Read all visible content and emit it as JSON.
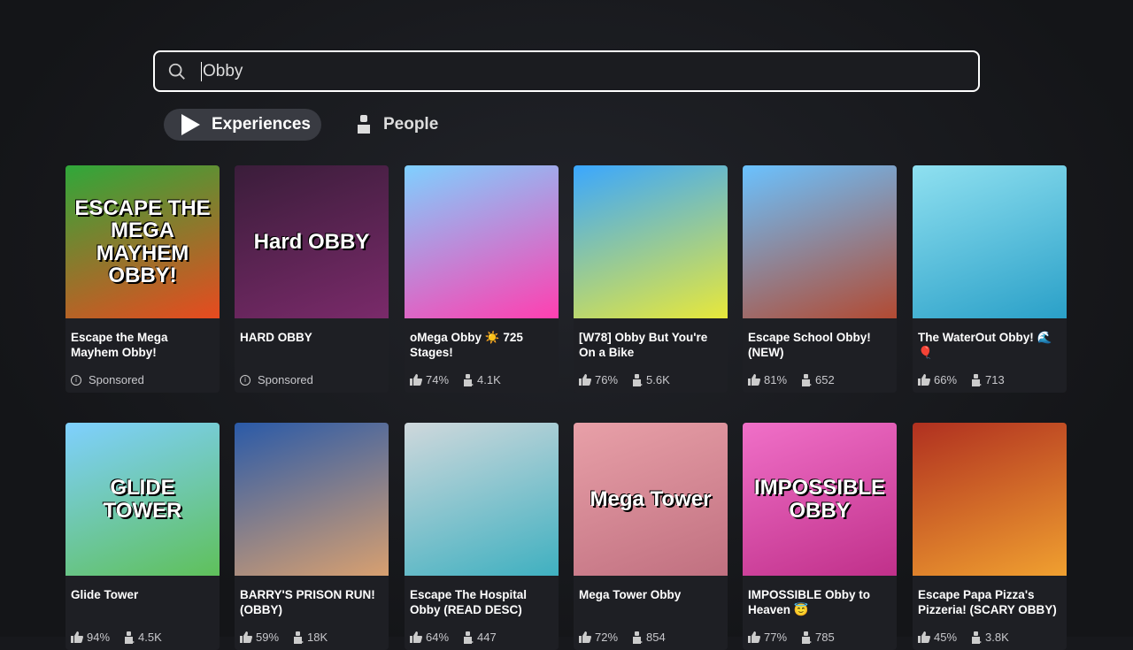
{
  "search": {
    "value": "Obby"
  },
  "tabs": [
    {
      "label": "Experiences",
      "active": true
    },
    {
      "label": "People",
      "active": false
    }
  ],
  "games": [
    {
      "title": "Escape the Mega Mayhem Obby!",
      "sponsored": "Sponsored",
      "thumb_text": "ESCAPE THE MEGA MAYHEM OBBY!",
      "colors": [
        "#2fa83a",
        "#e84a1f"
      ]
    },
    {
      "title": "HARD OBBY",
      "sponsored": "Sponsored",
      "thumb_text": "Hard OBBY",
      "colors": [
        "#3a1d3a",
        "#7a2a6a"
      ]
    },
    {
      "title": "oMega Obby ☀️ 725 Stages!",
      "rating": "74%",
      "players": "4.1K",
      "colors": [
        "#7fd0ff",
        "#ff3fb0"
      ]
    },
    {
      "title": "[W78] Obby But You're On a Bike",
      "rating": "76%",
      "players": "5.6K",
      "colors": [
        "#3aa7ff",
        "#e8e83a"
      ]
    },
    {
      "title": "Escape School Obby! (NEW)",
      "rating": "81%",
      "players": "652",
      "colors": [
        "#6ac2ff",
        "#b24a32"
      ]
    },
    {
      "title": "The WaterOut Obby! 🌊🎈",
      "rating": "66%",
      "players": "713",
      "colors": [
        "#8fe0f0",
        "#2aa0c8"
      ]
    },
    {
      "title": "Glide Tower",
      "rating": "94%",
      "players": "4.5K",
      "thumb_text": "GLIDE TOWER",
      "colors": [
        "#7fd0ff",
        "#5fc05a"
      ]
    },
    {
      "title": "BARRY'S PRISON RUN! (OBBY)",
      "rating": "59%",
      "players": "18K",
      "colors": [
        "#2a5aa8",
        "#d8a070"
      ]
    },
    {
      "title": "Escape The Hospital Obby (READ DESC)",
      "rating": "64%",
      "players": "447",
      "colors": [
        "#cfd8dc",
        "#3fb0c0"
      ]
    },
    {
      "title": "Mega Tower Obby",
      "rating": "72%",
      "players": "854",
      "thumb_text": "Mega Tower",
      "colors": [
        "#e8a0a8",
        "#c07080"
      ]
    },
    {
      "title": "IMPOSSIBLE Obby to Heaven 😇",
      "rating": "77%",
      "players": "785",
      "thumb_text": "IMPOSSIBLE OBBY",
      "colors": [
        "#f070c8",
        "#c0308a"
      ]
    },
    {
      "title": "Escape Papa Pizza's Pizzeria! (SCARY OBBY)",
      "rating": "45%",
      "players": "3.8K",
      "colors": [
        "#b03020",
        "#f0a030"
      ]
    }
  ]
}
